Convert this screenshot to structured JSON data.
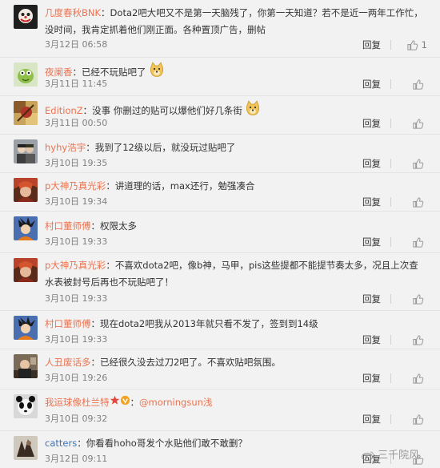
{
  "actions": {
    "reply_label": "回复"
  },
  "watermark": "三千院风",
  "comments": [
    {
      "user": "几度春秋BNK",
      "text": "Dota2吧大吧又不是第一天脑残了，你第一天知道？若不是近一两年工作忙，没时间，我肯定抓着他们刚正面。各种置顶广告，删帖",
      "time": "3月12日 06:58",
      "likes": "1"
    },
    {
      "user": "夜阑香",
      "text": "已经不玩贴吧了",
      "time": "3月11日 11:45",
      "likes": ""
    },
    {
      "user": "EditionZ",
      "text": "没事 你删过的贴可以爆他们好几条街",
      "time": "3月11日 00:50",
      "likes": ""
    },
    {
      "user": "hyhy浩宇",
      "text": "我到了12级以后，就没玩过贴吧了",
      "time": "3月10日 19:35",
      "likes": ""
    },
    {
      "user": "p大神乃真光彩",
      "text": "讲道理的话，max还行，勉强凑合",
      "time": "3月10日 19:34",
      "likes": ""
    },
    {
      "user": "村口董师傅",
      "text": "权限太多",
      "time": "3月10日 19:33",
      "likes": ""
    },
    {
      "user": "p大神乃真光彩",
      "text": "不喜欢dota2吧，像b神，马甲，pis这些提都不能提节奏太多，况且上次查水表被封号后再也不玩贴吧了！",
      "time": "3月10日 19:33",
      "likes": ""
    },
    {
      "user": "村口董师傅",
      "text": "现在dota2吧我从2013年就只看不发了，签到到14级",
      "time": "3月10日 19:33",
      "likes": ""
    },
    {
      "user": "人丑废话多",
      "text": "已经很久没去过刀2吧了。不喜欢贴吧氛围。",
      "time": "3月10日 19:26",
      "likes": ""
    },
    {
      "user": "我运球像杜兰特",
      "text": "@morningsun浅",
      "time": "3月10日 09:32",
      "likes": ""
    },
    {
      "user": "catters",
      "text": "你看看hoho哥发个水贴他们敢不敢删？",
      "time": "3月12日 09:11",
      "likes": ""
    }
  ]
}
